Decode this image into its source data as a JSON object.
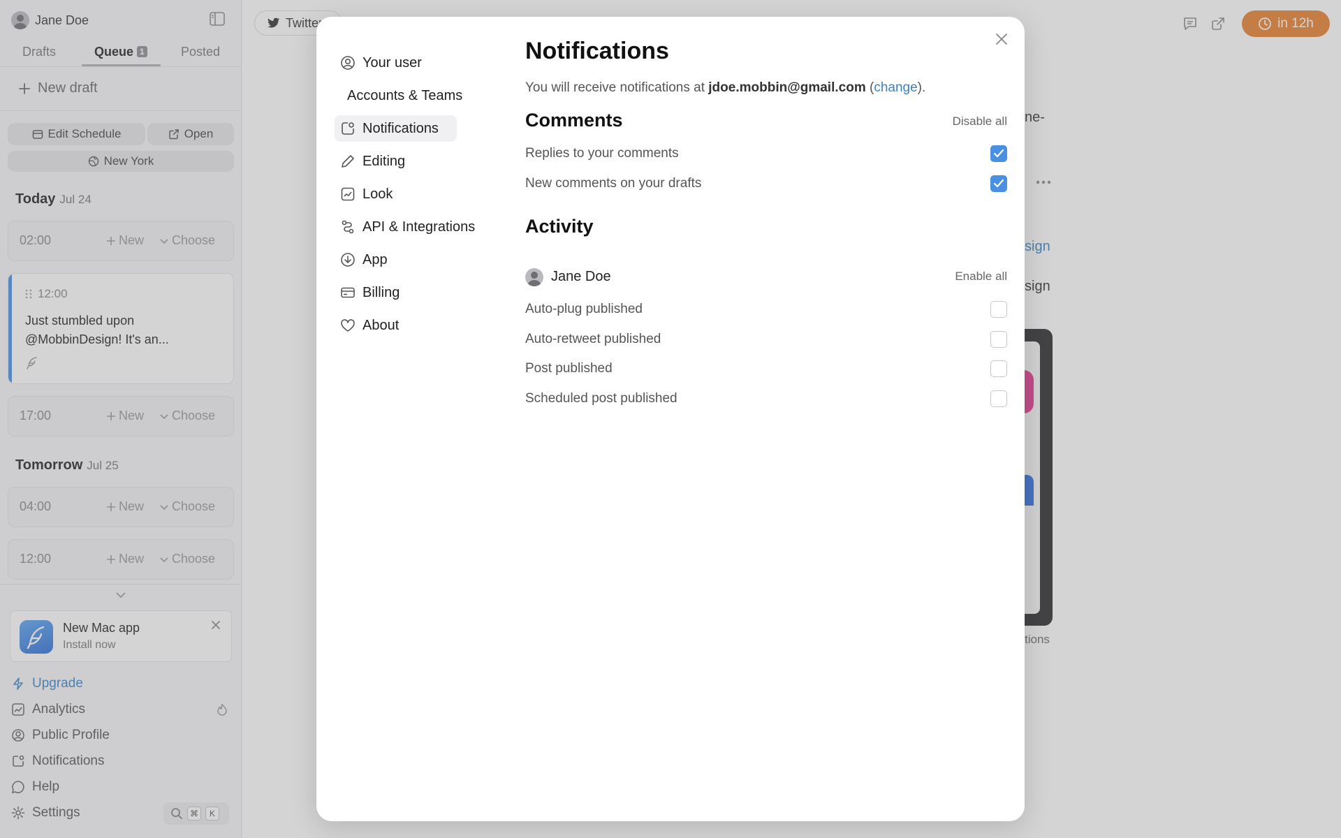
{
  "sidebar": {
    "user_name": "Jane Doe",
    "tabs": [
      {
        "label": "Drafts"
      },
      {
        "label": "Queue",
        "count": "1"
      },
      {
        "label": "Posted"
      }
    ],
    "new_draft": "New draft",
    "edit_schedule": "Edit Schedule",
    "open": "Open",
    "timezone": "New York",
    "days": [
      {
        "title": "Today",
        "date": "Jul 24"
      },
      {
        "title": "Tomorrow",
        "date": "Jul 25"
      }
    ],
    "slots": [
      {
        "time": "02:00",
        "new": "New",
        "choose": "Choose"
      },
      {
        "time": "17:00",
        "new": "New",
        "choose": "Choose"
      },
      {
        "time": "04:00",
        "new": "New",
        "choose": "Choose"
      },
      {
        "time": "12:00",
        "new": "New",
        "choose": "Choose"
      }
    ],
    "scheduled_post": {
      "time": "12:00",
      "text": "Just stumbled upon @MobbinDesign! It's an..."
    },
    "promo": {
      "title": "New Mac app",
      "subtitle": "Install now"
    },
    "nav": [
      {
        "label": "Upgrade"
      },
      {
        "label": "Analytics"
      },
      {
        "label": "Public Profile"
      },
      {
        "label": "Notifications"
      },
      {
        "label": "Help"
      },
      {
        "label": "Settings"
      }
    ],
    "shortcut": {
      "cmd": "⌘",
      "key": "K"
    }
  },
  "main": {
    "account_tab": "Twitter",
    "publish_timer": "in 12h",
    "bg_fragments": [
      "ne-",
      "sign",
      "sign",
      "tions"
    ]
  },
  "modal": {
    "nav": [
      {
        "label": "Your user",
        "icon": "user-circle-icon"
      },
      {
        "label": "Accounts & Teams",
        "icon": "users-icon"
      },
      {
        "label": "Notifications",
        "icon": "notification-icon"
      },
      {
        "label": "Editing",
        "icon": "pencil-icon"
      },
      {
        "label": "Look",
        "icon": "chart-icon"
      },
      {
        "label": "API & Integrations",
        "icon": "integration-icon"
      },
      {
        "label": "App",
        "icon": "download-icon"
      },
      {
        "label": "Billing",
        "icon": "card-icon"
      },
      {
        "label": "About",
        "icon": "heart-icon"
      }
    ],
    "title": "Notifications",
    "intro_prefix": "You will receive notifications at ",
    "email": "jdoe.mobbin@gmail.com",
    "intro_open": " (",
    "change_link": "change",
    "intro_close": ").",
    "comments": {
      "heading": "Comments",
      "action": "Disable all",
      "items": [
        {
          "label": "Replies to your comments",
          "checked": true
        },
        {
          "label": "New comments on your drafts",
          "checked": true
        }
      ]
    },
    "activity": {
      "heading": "Activity",
      "user": "Jane Doe",
      "action": "Enable all",
      "items": [
        {
          "label": "Auto-plug published",
          "checked": false
        },
        {
          "label": "Auto-retweet published",
          "checked": false
        },
        {
          "label": "Post published",
          "checked": false
        },
        {
          "label": "Scheduled post published",
          "checked": false
        }
      ]
    }
  }
}
